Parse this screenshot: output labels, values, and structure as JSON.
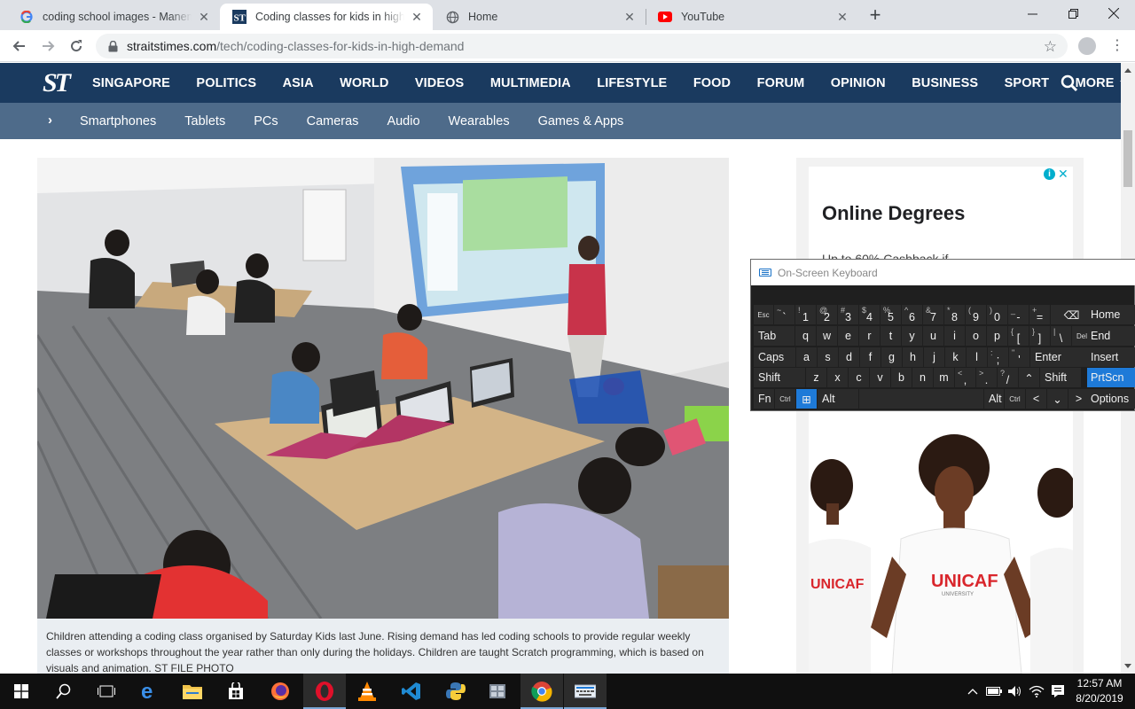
{
  "browser": {
    "tabs": [
      {
        "title": "coding school images - Manema",
        "favicon": "google-icon",
        "active": false
      },
      {
        "title": "Coding classes for kids in high de",
        "favicon": "straits-times-icon",
        "active": true
      },
      {
        "title": "Home",
        "favicon": "globe-icon",
        "active": false
      },
      {
        "title": "YouTube",
        "favicon": "youtube-icon",
        "active": false
      }
    ],
    "new_tab_label": "+",
    "url_host": "straitstimes.com",
    "url_path": "/tech/coding-classes-for-kids-in-high-demand"
  },
  "site": {
    "logo": "ST",
    "nav": [
      "SINGAPORE",
      "POLITICS",
      "ASIA",
      "WORLD",
      "VIDEOS",
      "MULTIMEDIA",
      "LIFESTYLE",
      "FOOD",
      "FORUM",
      "OPINION",
      "BUSINESS",
      "SPORT",
      "MORE"
    ],
    "subnav": [
      "Smartphones",
      "Tablets",
      "PCs",
      "Cameras",
      "Audio",
      "Wearables",
      "Games & Apps"
    ]
  },
  "article": {
    "caption": "Children attending a coding class organised by Saturday Kids last June. Rising demand has led coding schools to provide regular weekly classes or workshops throughout the year rather than only during the holidays. Children are taught Scratch programming, which is based on visuals and animation. ST FILE PHOTO"
  },
  "ad": {
    "title": "Online Degrees",
    "subtitle": "Up to 60% Cashback if",
    "brand_tshirt": "UNICAF",
    "brand_sub": "UNIVERSITY"
  },
  "osk": {
    "title": "On-Screen Keyboard",
    "rows": [
      [
        {
          "s": "",
          "m": "Esc",
          "small": true
        },
        {
          "s": "~",
          "m": "`"
        },
        {
          "s": "!",
          "m": "1"
        },
        {
          "s": "@",
          "m": "2"
        },
        {
          "s": "#",
          "m": "3"
        },
        {
          "s": "$",
          "m": "4"
        },
        {
          "s": "%",
          "m": "5"
        },
        {
          "s": "^",
          "m": "6"
        },
        {
          "s": "&",
          "m": "7"
        },
        {
          "s": "*",
          "m": "8"
        },
        {
          "s": "(",
          "m": "9"
        },
        {
          "s": ")",
          "m": "0"
        },
        {
          "s": "_",
          "m": "-"
        },
        {
          "s": "+",
          "m": "="
        },
        {
          "s": "",
          "m": "⌫"
        }
      ],
      [
        {
          "s": "",
          "m": "Tab"
        },
        {
          "s": "",
          "m": "q"
        },
        {
          "s": "",
          "m": "w"
        },
        {
          "s": "",
          "m": "e"
        },
        {
          "s": "",
          "m": "r"
        },
        {
          "s": "",
          "m": "t"
        },
        {
          "s": "",
          "m": "y"
        },
        {
          "s": "",
          "m": "u"
        },
        {
          "s": "",
          "m": "i"
        },
        {
          "s": "",
          "m": "o"
        },
        {
          "s": "",
          "m": "p"
        },
        {
          "s": "{",
          "m": "["
        },
        {
          "s": "}",
          "m": "]"
        },
        {
          "s": "|",
          "m": "\\"
        },
        {
          "s": "",
          "m": "Del",
          "small": true
        }
      ],
      [
        {
          "s": "",
          "m": "Caps"
        },
        {
          "s": "",
          "m": "a"
        },
        {
          "s": "",
          "m": "s"
        },
        {
          "s": "",
          "m": "d"
        },
        {
          "s": "",
          "m": "f"
        },
        {
          "s": "",
          "m": "g"
        },
        {
          "s": "",
          "m": "h"
        },
        {
          "s": "",
          "m": "j"
        },
        {
          "s": "",
          "m": "k"
        },
        {
          "s": "",
          "m": "l"
        },
        {
          "s": ":",
          "m": ";"
        },
        {
          "s": "\"",
          "m": "'"
        },
        {
          "s": "",
          "m": "Enter"
        }
      ],
      [
        {
          "s": "",
          "m": "Shift"
        },
        {
          "s": "",
          "m": "z"
        },
        {
          "s": "",
          "m": "x"
        },
        {
          "s": "",
          "m": "c"
        },
        {
          "s": "",
          "m": "v"
        },
        {
          "s": "",
          "m": "b"
        },
        {
          "s": "",
          "m": "n"
        },
        {
          "s": "",
          "m": "m"
        },
        {
          "s": "<",
          "m": ","
        },
        {
          "s": ">",
          "m": "."
        },
        {
          "s": "?",
          "m": "/"
        },
        {
          "s": "",
          "m": "⌃"
        },
        {
          "s": "",
          "m": "Shift"
        }
      ],
      [
        {
          "s": "",
          "m": "Fn"
        },
        {
          "s": "",
          "m": "Ctrl",
          "small": true
        },
        {
          "s": "",
          "m": "⊞",
          "win": true
        },
        {
          "s": "",
          "m": "Alt"
        },
        {
          "s": "",
          "m": ""
        },
        {
          "s": "",
          "m": "Alt"
        },
        {
          "s": "",
          "m": "Ctrl",
          "small": true
        },
        {
          "s": "",
          "m": "<"
        },
        {
          "s": "",
          "m": "⌄"
        },
        {
          "s": "",
          "m": ">"
        },
        {
          "s": "",
          "m": "▤"
        }
      ]
    ],
    "side": [
      "Home",
      "End",
      "Insert",
      "PrtScn",
      "Options"
    ],
    "highlighted_side": "PrtScn"
  },
  "taskbar": {
    "time": "12:57 AM",
    "date": "8/20/2019"
  },
  "colors": {
    "site_nav": "#1a3a5f",
    "site_subnav": "#4e6b8a",
    "osk_accent": "#1e7ad8"
  }
}
